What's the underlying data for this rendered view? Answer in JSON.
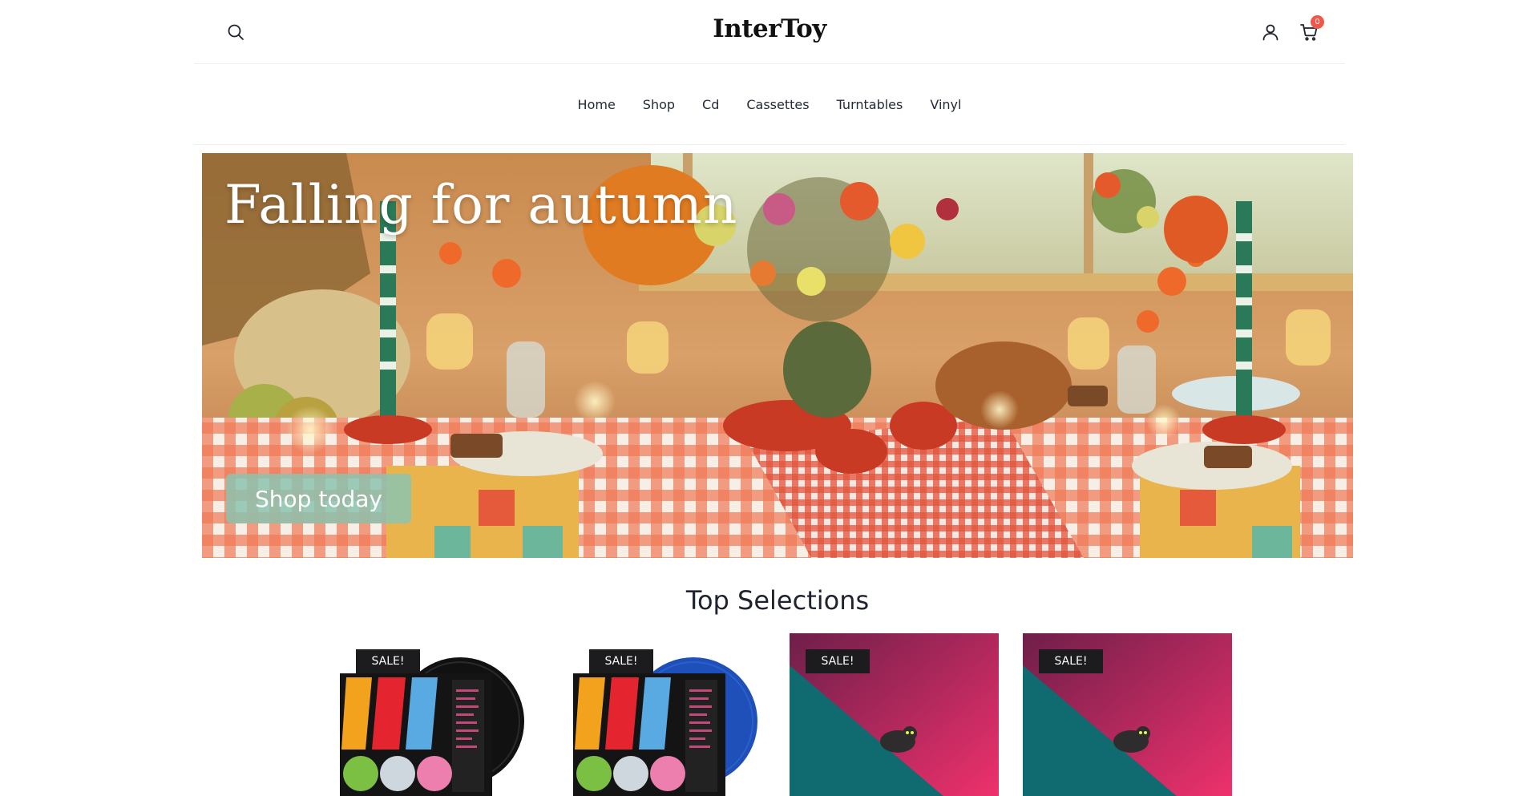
{
  "header": {
    "logo": "InterToy",
    "cart_count": "0"
  },
  "nav": {
    "items": [
      {
        "label": "Home"
      },
      {
        "label": "Shop"
      },
      {
        "label": "Cd"
      },
      {
        "label": "Cassettes"
      },
      {
        "label": "Turntables"
      },
      {
        "label": "Vinyl"
      }
    ]
  },
  "hero": {
    "title": "Falling for autumn",
    "cta_label": "Shop today"
  },
  "top_selections": {
    "title": "Top Selections",
    "products": [
      {
        "badge": "SALE!",
        "art": "black-vinyl-album"
      },
      {
        "badge": "SALE!",
        "art": "blue-vinyl-album"
      },
      {
        "badge": "SALE!",
        "art": "cat-pink-teal-cover"
      },
      {
        "badge": "SALE!",
        "art": "cat-pink-teal-cover"
      }
    ]
  },
  "colors": {
    "badge_bg": "#1c1c1e",
    "cart_badge": "#f0584c",
    "cta_bg": "#8cc3af"
  }
}
